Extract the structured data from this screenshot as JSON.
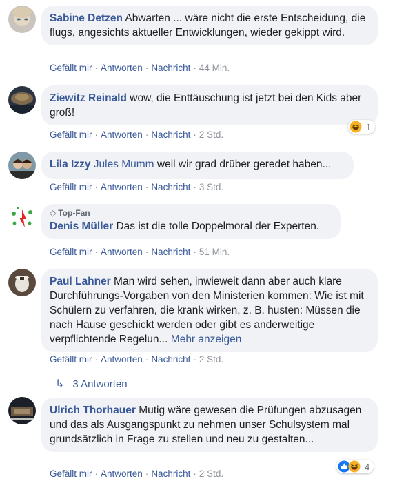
{
  "actions": {
    "like": "Gefällt mir",
    "reply": "Antworten",
    "message": "Nachricht",
    "separator": "·"
  },
  "comments": [
    {
      "author": "Sabine Detzen",
      "text": "Abwarten ... wäre nicht die erste Entscheidung, die flugs, angesichts aktueller Entwicklungen, wieder gekippt wird.",
      "time": "44 Min."
    },
    {
      "author": "Ziewitz Reinald",
      "text": "wow, die Enttäuschung ist jetzt bei den Kids aber groß!",
      "time": "2 Std.",
      "reactions": [
        "haha-icon"
      ],
      "reaction_count": "1"
    },
    {
      "author": "Lila Izzy",
      "tagged": "Jules Mumm",
      "text": "weil wir grad drüber geredet haben...",
      "time": "3 Std."
    },
    {
      "badge": "Top-Fan",
      "author": "Denis Müller",
      "text": "Das ist die tolle Doppelmoral der Experten.",
      "time": "51 Min."
    },
    {
      "author": "Paul Lahner",
      "text": "Man wird sehen, inwieweit dann aber auch klare Durchführungs-Vorgaben von den Ministerien kommen: Wie ist mit Schülern zu verfahren, die krank wirken, z. B. husten: Müssen die nach Hause geschickt werden oder gibt es anderweitige verpflichtende Regelun...",
      "more": "Mehr anzeigen",
      "time": "2 Std.",
      "replies": "3 Antworten"
    },
    {
      "author": "Ulrich Thorhauer",
      "text": "Mutig wäre gewesen die Prüfungen abzusagen und das als Ausgangspunkt zu nehmen unser Schulsystem mal grundsätzlich in Frage zu stellen und neu zu gestalten...",
      "time": "2 Std.",
      "reactions": [
        "like-icon",
        "haha-icon"
      ],
      "reaction_count": "4"
    }
  ],
  "colors": {
    "link": "#385898",
    "bubble": "#f0f2f5",
    "meta": "#90949c",
    "like_blue": "#1877f2",
    "haha_yellow": "#f7b125"
  }
}
